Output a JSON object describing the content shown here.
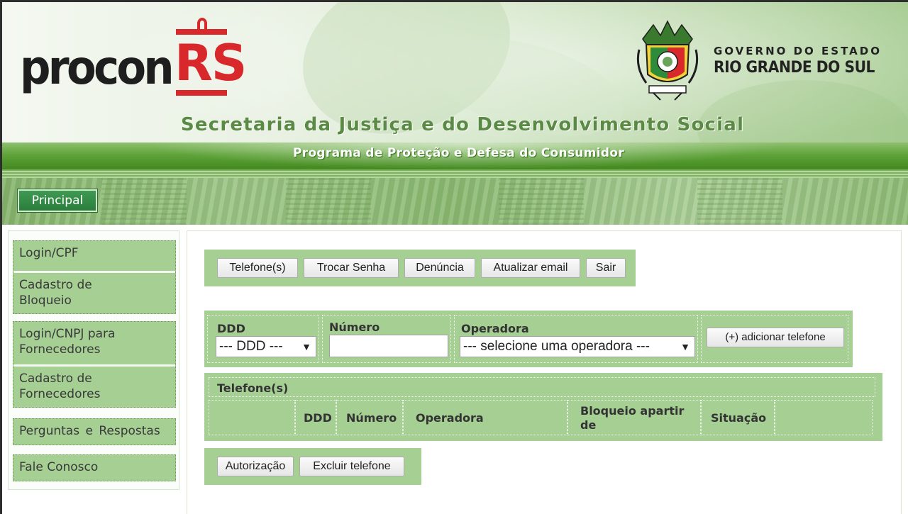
{
  "header": {
    "logo_word": "procon",
    "logo_suffix": "RS",
    "gov_line1": "GOVERNO DO ESTADO",
    "gov_line2": "RIO GRANDE DO SUL",
    "secretaria": "Secretaria da Justiça e do Desenvolvimento Social",
    "programa": "Programa de Proteção e Defesa do Consumidor"
  },
  "nav": {
    "principal": "Principal"
  },
  "sidebar": {
    "groups": [
      [
        "Login/CPF",
        "Cadastro de\nBloqueio"
      ],
      [
        "Login/CNPJ para\nFornecedores",
        "Cadastro de\nFornecedores"
      ],
      [
        "Perguntas e Respostas"
      ],
      [
        "Fale Conosco"
      ]
    ]
  },
  "toolbar": {
    "telefones": "Telefone(s)",
    "trocar_senha": "Trocar Senha",
    "denuncia": "Denúncia",
    "atualizar_email": "Atualizar email",
    "sair": "Sair"
  },
  "form": {
    "ddd_label": "DDD",
    "ddd_value": "--- DDD ---",
    "numero_label": "Número",
    "numero_value": "",
    "operadora_label": "Operadora",
    "operadora_value": "--- selecione uma operadora ---",
    "add_button": "(+) adicionar telefone"
  },
  "table": {
    "caption": "Telefone(s)",
    "columns": [
      "",
      "DDD",
      "Número",
      "Operadora",
      "Bloqueio apartir de",
      "Situação",
      ""
    ]
  },
  "actions": {
    "autorizacao": "Autorização",
    "excluir": "Excluir telefone"
  },
  "colors": {
    "panel_green": "#a6cf94",
    "brand_red": "#d8282c",
    "nav_button": "#2b7d3c"
  }
}
